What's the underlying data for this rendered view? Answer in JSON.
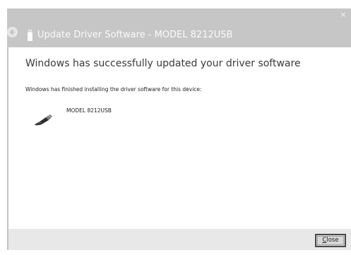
{
  "window": {
    "title": "Update Driver Software - MODEL 8212USB",
    "close_glyph": "×"
  },
  "content": {
    "heading": "Windows has successfully updated your driver software",
    "message": "Windows has finished installing the driver software for this device:",
    "device_name": "MODEL 8212USB"
  },
  "footer": {
    "close_mnemonic": "C",
    "close_rest": "lose"
  },
  "icons": {
    "back": "back-arrow-icon",
    "title_device": "usb-device-icon",
    "device": "usb-cable-icon"
  },
  "colors": {
    "titlebar": "#c6c6c6",
    "content_bg": "#ffffff",
    "footer_bg": "#e8e8e8",
    "heading_text": "#3a3a3a"
  }
}
